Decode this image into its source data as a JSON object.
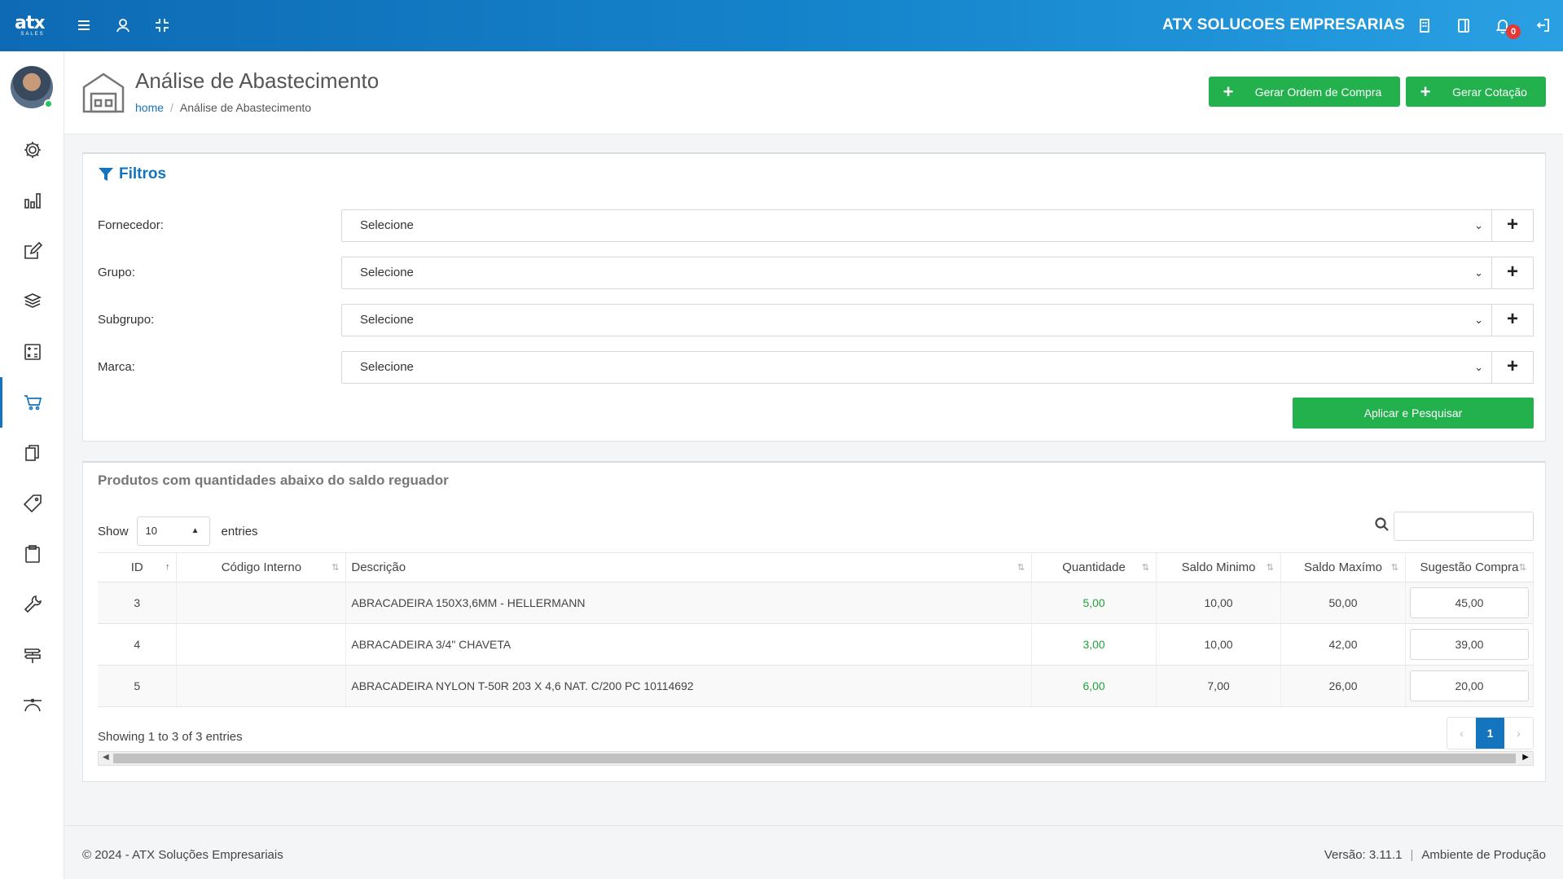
{
  "topbar": {
    "logo_word": "atx",
    "logo_sub": "SALES",
    "company": "ATX SOLUCOES EMPRESARIAS",
    "notification_count": "0",
    "icons": [
      "menu-icon",
      "user-icon",
      "compress-icon",
      "building-icon",
      "panel-icon",
      "bell-icon",
      "logout-icon"
    ]
  },
  "sidebar": {
    "items": [
      {
        "name": "settings",
        "icon": "gear-icon"
      },
      {
        "name": "reports",
        "icon": "bar-chart-icon"
      },
      {
        "name": "edit",
        "icon": "edit-icon"
      },
      {
        "name": "products",
        "icon": "boxes-icon"
      },
      {
        "name": "calculator",
        "icon": "calculator-icon"
      },
      {
        "name": "purchases",
        "icon": "cart-icon",
        "active": true
      },
      {
        "name": "documents",
        "icon": "documents-icon"
      },
      {
        "name": "tags",
        "icon": "tag-icon"
      },
      {
        "name": "orders",
        "icon": "clipboard-icon"
      },
      {
        "name": "tools",
        "icon": "wrench-icon"
      },
      {
        "name": "signpost",
        "icon": "signpost-icon"
      },
      {
        "name": "routes",
        "icon": "bezier-icon"
      }
    ]
  },
  "header": {
    "title": "Análise de Abastecimento",
    "breadcrumb_home": "home",
    "breadcrumb_current": "Análise de Abastecimento",
    "btn_ordem": "Gerar Ordem de Compra",
    "btn_cotacao": "Gerar Cotação"
  },
  "filters": {
    "title": "Filtros",
    "rows": [
      {
        "label": "Fornecedor:",
        "value": "Selecione"
      },
      {
        "label": "Grupo:",
        "value": "Selecione"
      },
      {
        "label": "Subgrupo:",
        "value": "Selecione"
      },
      {
        "label": "Marca:",
        "value": "Selecione"
      }
    ],
    "apply_label": "Aplicar e Pesquisar"
  },
  "table": {
    "title": "Produtos com quantidades abaixo do saldo reguador",
    "show_label": "Show",
    "entries_label": "entries",
    "page_length": "10",
    "columns": [
      "ID",
      "Código Interno",
      "Descrição",
      "Quantidade",
      "Saldo Minimo",
      "Saldo Maxímo",
      "Sugestão Compra"
    ],
    "rows": [
      {
        "id": "3",
        "codigo": "",
        "descricao": "ABRACADEIRA 150X3,6MM - HELLERMANN",
        "quantidade": "5,00",
        "saldo_min": "10,00",
        "saldo_max": "50,00",
        "sugestao": "45,00"
      },
      {
        "id": "4",
        "codigo": "",
        "descricao": "ABRACADEIRA 3/4\" CHAVETA",
        "quantidade": "3,00",
        "saldo_min": "10,00",
        "saldo_max": "42,00",
        "sugestao": "39,00"
      },
      {
        "id": "5",
        "codigo": "",
        "descricao": "ABRACADEIRA NYLON T-50R 203 X 4,6 NAT. C/200 PC 10114692",
        "quantidade": "6,00",
        "saldo_min": "7,00",
        "saldo_max": "26,00",
        "sugestao": "20,00"
      }
    ],
    "showing": "Showing 1 to 3 of 3 entries",
    "current_page": "1"
  },
  "footer": {
    "copyright": "© 2024 - ATX Soluções Empresariais",
    "version": "Versão: 3.11.1",
    "environment": "Ambiente de Produção"
  }
}
